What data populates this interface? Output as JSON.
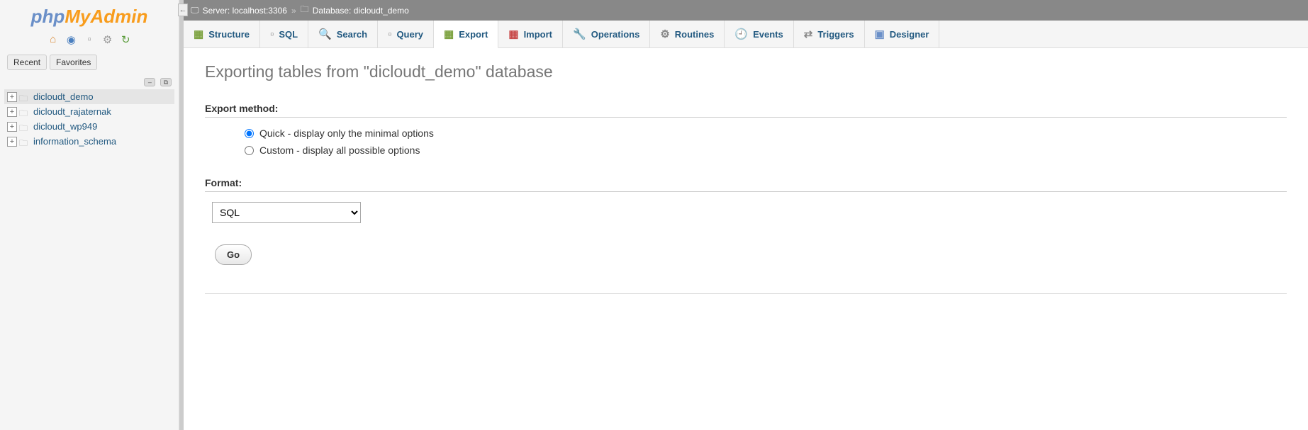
{
  "logo": {
    "p1": "php",
    "p2": "MyAdmin"
  },
  "sidebar_tabs": {
    "recent": "Recent",
    "favorites": "Favorites"
  },
  "databases": [
    {
      "name": "dicloudt_demo",
      "active": true
    },
    {
      "name": "dicloudt_rajaternak",
      "active": false
    },
    {
      "name": "dicloudt_wp949",
      "active": false
    },
    {
      "name": "information_schema",
      "active": false
    }
  ],
  "breadcrumb": {
    "server_label": "Server: localhost:3306",
    "db_label": "Database: dicloudt_demo"
  },
  "tabs": [
    {
      "key": "structure",
      "label": "Structure"
    },
    {
      "key": "sql",
      "label": "SQL"
    },
    {
      "key": "search",
      "label": "Search"
    },
    {
      "key": "query",
      "label": "Query"
    },
    {
      "key": "export",
      "label": "Export",
      "active": true
    },
    {
      "key": "import",
      "label": "Import"
    },
    {
      "key": "operations",
      "label": "Operations"
    },
    {
      "key": "routines",
      "label": "Routines"
    },
    {
      "key": "events",
      "label": "Events"
    },
    {
      "key": "triggers",
      "label": "Triggers"
    },
    {
      "key": "designer",
      "label": "Designer"
    }
  ],
  "page": {
    "heading": "Exporting tables from \"dicloudt_demo\" database",
    "export_method_label": "Export method:",
    "export_quick": "Quick - display only the minimal options",
    "export_custom": "Custom - display all possible options",
    "format_label": "Format:",
    "format_value": "SQL",
    "go": "Go"
  },
  "tab_glyphs": {
    "structure": "▦",
    "sql": "▫",
    "search": "🔍",
    "query": "▫",
    "export": "▦",
    "import": "▦",
    "operations": "🔧",
    "routines": "⚙",
    "events": "🕘",
    "triggers": "⇄",
    "designer": "▣"
  }
}
